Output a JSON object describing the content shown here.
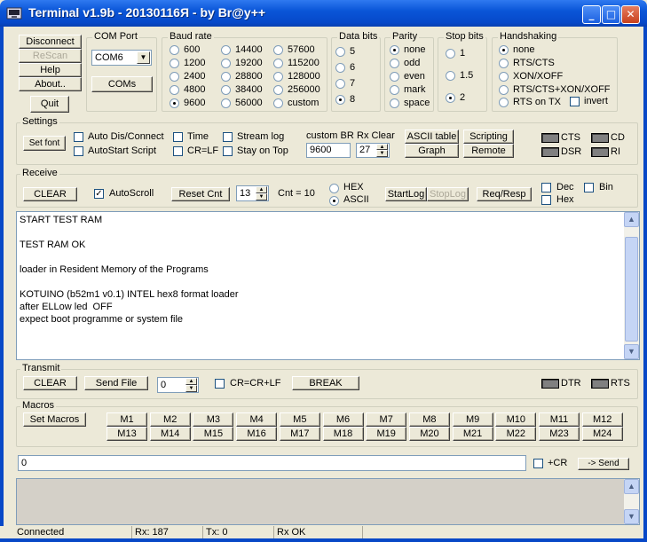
{
  "window": {
    "title": "Terminal v1.9b - 20130116Я - by Br@y++",
    "min": "_",
    "max": "□",
    "close": "✕"
  },
  "conn": {
    "connect": "Disconnect",
    "rescan": "ReScan",
    "help": "Help",
    "about": "About..",
    "quit": "Quit"
  },
  "com": {
    "label": "COM Port",
    "value": "COM6",
    "coms_button": "COMs"
  },
  "baud": {
    "label": "Baud rate",
    "options": [
      "600",
      "1200",
      "2400",
      "4800",
      "9600",
      "14400",
      "19200",
      "28800",
      "38400",
      "56000",
      "57600",
      "115200",
      "128000",
      "256000",
      "custom"
    ],
    "selected": "9600"
  },
  "databits": {
    "label": "Data bits",
    "options": [
      "5",
      "6",
      "7",
      "8"
    ],
    "selected": "8"
  },
  "parity": {
    "label": "Parity",
    "options": [
      "none",
      "odd",
      "even",
      "mark",
      "space"
    ],
    "selected": "none"
  },
  "stopbits": {
    "label": "Stop bits",
    "options": [
      "1",
      "1.5",
      "2"
    ],
    "selected": "2"
  },
  "handshaking": {
    "label": "Handshaking",
    "options": [
      "none",
      "RTS/CTS",
      "XON/XOFF",
      "RTS/CTS+XON/XOFF",
      "RTS on TX"
    ],
    "selected": "none",
    "invert": "invert"
  },
  "settings": {
    "label": "Settings",
    "set_font": "Set font",
    "auto_dis": "Auto Dis/Connect",
    "autostart": "AutoStart Script",
    "time": "Time",
    "crlf": "CR=LF",
    "stream_log": "Stream log",
    "stay_on_top": "Stay on Top",
    "custom_br_label": "custom BR",
    "custom_br_value": "9600",
    "rx_clear_label": "Rx Clear",
    "rx_clear_value": "27",
    "ascii_table": "ASCII table",
    "graph": "Graph",
    "scripting": "Scripting",
    "remote": "Remote",
    "cts": "CTS",
    "cd": "CD",
    "dsr": "DSR",
    "ri": "RI"
  },
  "receive": {
    "label": "Receive",
    "clear": "CLEAR",
    "autoscroll": "AutoScroll",
    "reset_cnt": "Reset Cnt",
    "cnt_value": "13",
    "cnt_label": "Cnt =  10",
    "hex": "HEX",
    "ascii": "ASCII",
    "mode": "ASCII",
    "startlog": "StartLog",
    "stoplog": "StopLog",
    "req_resp": "Req/Resp",
    "dec": "Dec",
    "bin": "Bin",
    "hex_cb": "Hex",
    "lines": [
      "START TEST RAM",
      "",
      "TEST RAM OK",
      "",
      "loader in Resident Memory of the Programs",
      "",
      "KOTUINO (b52m1 v0.1) INTEL hex8 format loader",
      "after ELLow led  OFF",
      "expect boot programme or system file"
    ]
  },
  "transmit": {
    "label": "Transmit",
    "clear": "CLEAR",
    "send_file": "Send File",
    "counter": "0",
    "crcrlf": "CR=CR+LF",
    "break": "BREAK",
    "dtr": "DTR",
    "rts": "RTS"
  },
  "macros": {
    "label": "Macros",
    "set_macros": "Set Macros",
    "items": [
      "M1",
      "M2",
      "M3",
      "M4",
      "M5",
      "M6",
      "M7",
      "M8",
      "M9",
      "M10",
      "M11",
      "M12",
      "M13",
      "M14",
      "M15",
      "M16",
      "M17",
      "M18",
      "M19",
      "M20",
      "M21",
      "M22",
      "M23",
      "M24"
    ]
  },
  "send": {
    "input": "0",
    "cr": "+CR",
    "button": "-> Send"
  },
  "status": {
    "conn": "Connected",
    "rx": "Rx: 187",
    "tx": "Tx: 0",
    "rxok": "Rx OK"
  },
  "icons": {
    "app": "terminal-app-icon",
    "dropdown": "chevron-down-icon",
    "spin": "spin-arrows-icon",
    "led": "led-indicator-icon"
  },
  "colors": {
    "titlebar": "#0a56d8",
    "face": "#ece9d8",
    "led_off": "#808080"
  }
}
